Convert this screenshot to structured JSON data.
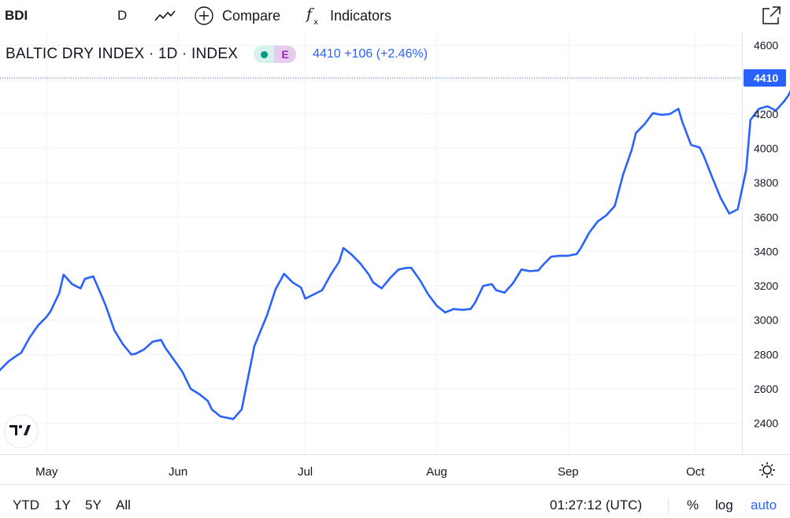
{
  "toolbar": {
    "symbol": "BDI",
    "interval": "D",
    "compare_label": "Compare",
    "indicators_label": "Indicators",
    "icons": [
      "line-style-icon",
      "plus-circle-icon",
      "function-icon",
      "fullscreen-icon"
    ]
  },
  "legend": {
    "title": "BALTIC DRY INDEX · 1D · INDEX",
    "badge_letter": "E",
    "value": "4410 +106 (+2.46%)"
  },
  "colors": {
    "line": "#2962ff",
    "accent": "#2962ff",
    "grid": "#f0f3fa",
    "badge_green": "#089981",
    "badge_purple": "#9c27b0"
  },
  "chart_data": {
    "type": "line",
    "x_ticks": [
      {
        "label": "May",
        "x": 0
      },
      {
        "label": "Jun",
        "x": 31
      },
      {
        "label": "Jul",
        "x": 61
      },
      {
        "label": "Aug",
        "x": 92
      },
      {
        "label": "Sep",
        "x": 123
      },
      {
        "label": "Oct",
        "x": 153
      }
    ],
    "y_ticks": [
      2400,
      2600,
      2800,
      3000,
      3200,
      3400,
      3600,
      3800,
      4000,
      4200,
      4400,
      4600
    ],
    "y_labels": [
      "2400",
      "2600",
      "2800",
      "3000",
      "3200",
      "3400",
      "3600",
      "3800",
      "4000",
      "4200",
      "4600"
    ],
    "ylim": [
      2220,
      4680
    ],
    "xlim": [
      -11,
      164
    ],
    "last_price_label": "4410",
    "last_price": 4410,
    "series": [
      {
        "values": [
          [
            -11,
            2710
          ],
          [
            -9,
            2760
          ],
          [
            -7,
            2795
          ],
          [
            -6,
            2810
          ],
          [
            -4,
            2900
          ],
          [
            -2,
            2970
          ],
          [
            0,
            3020
          ],
          [
            1,
            3055
          ],
          [
            3,
            3160
          ],
          [
            4,
            3265
          ],
          [
            6,
            3210
          ],
          [
            8,
            3185
          ],
          [
            9,
            3240
          ],
          [
            11,
            3255
          ],
          [
            13,
            3140
          ],
          [
            14,
            3080
          ],
          [
            16,
            2940
          ],
          [
            18,
            2860
          ],
          [
            20,
            2800
          ],
          [
            21,
            2805
          ],
          [
            23,
            2830
          ],
          [
            25,
            2875
          ],
          [
            27,
            2885
          ],
          [
            28,
            2840
          ],
          [
            30,
            2770
          ],
          [
            32,
            2700
          ],
          [
            34,
            2600
          ],
          [
            36,
            2570
          ],
          [
            38,
            2530
          ],
          [
            39,
            2480
          ],
          [
            41,
            2440
          ],
          [
            44,
            2425
          ],
          [
            46,
            2480
          ],
          [
            49,
            2850
          ],
          [
            52,
            3030
          ],
          [
            54,
            3180
          ],
          [
            56,
            3270
          ],
          [
            58,
            3220
          ],
          [
            60,
            3190
          ],
          [
            61,
            3125
          ],
          [
            63,
            3150
          ],
          [
            65,
            3175
          ],
          [
            67,
            3265
          ],
          [
            69,
            3340
          ],
          [
            70,
            3420
          ],
          [
            72,
            3380
          ],
          [
            74,
            3330
          ],
          [
            76,
            3265
          ],
          [
            77,
            3220
          ],
          [
            79,
            3185
          ],
          [
            81,
            3245
          ],
          [
            83,
            3295
          ],
          [
            85,
            3305
          ],
          [
            86,
            3305
          ],
          [
            88,
            3235
          ],
          [
            90,
            3150
          ],
          [
            92,
            3085
          ],
          [
            94,
            3045
          ],
          [
            96,
            3065
          ],
          [
            98,
            3060
          ],
          [
            100,
            3065
          ],
          [
            101,
            3100
          ],
          [
            103,
            3200
          ],
          [
            105,
            3210
          ],
          [
            106,
            3175
          ],
          [
            108,
            3160
          ],
          [
            110,
            3215
          ],
          [
            112,
            3295
          ],
          [
            114,
            3285
          ],
          [
            116,
            3290
          ],
          [
            117,
            3320
          ],
          [
            119,
            3370
          ],
          [
            121,
            3375
          ],
          [
            123,
            3375
          ],
          [
            125,
            3385
          ],
          [
            126,
            3420
          ],
          [
            128,
            3510
          ],
          [
            130,
            3575
          ],
          [
            132,
            3610
          ],
          [
            134,
            3665
          ],
          [
            136,
            3850
          ],
          [
            138,
            3990
          ],
          [
            139,
            4090
          ],
          [
            141,
            4140
          ],
          [
            143,
            4205
          ],
          [
            145,
            4195
          ],
          [
            147,
            4200
          ],
          [
            149,
            4230
          ],
          [
            150,
            4150
          ],
          [
            152,
            4020
          ],
          [
            154,
            4005
          ],
          [
            155,
            3955
          ],
          [
            157,
            3830
          ],
          [
            159,
            3710
          ],
          [
            161,
            3620
          ],
          [
            163,
            3645
          ],
          [
            165,
            3875
          ],
          [
            166,
            4165
          ],
          [
            168,
            4230
          ],
          [
            170,
            4245
          ],
          [
            172,
            4220
          ],
          [
            174,
            4275
          ],
          [
            175,
            4310
          ],
          [
            177,
            4410
          ]
        ]
      }
    ]
  },
  "bottom": {
    "ranges": [
      "YTD",
      "1Y",
      "5Y",
      "All"
    ],
    "clock": "01:27:12 (UTC)",
    "pct": "%",
    "log": "log",
    "auto": "auto"
  }
}
